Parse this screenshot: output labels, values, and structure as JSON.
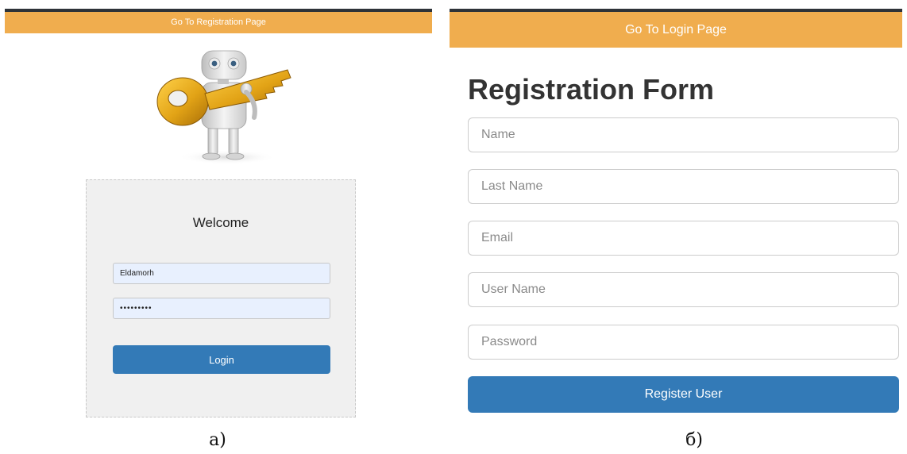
{
  "colors": {
    "topbar_bg": "#f0ad4e",
    "topbar_border": "#2e3338",
    "primary_button": "#337ab7",
    "login_box_bg": "#f0f0f0",
    "autofill_bg": "#e8f0fe"
  },
  "login_page": {
    "topbar_link": "Go To Registration Page",
    "illustration_icon": "robot-with-key-icon",
    "heading": "Welcome",
    "username_value": "Eldamorh",
    "password_value": "•••••••••",
    "login_label": "Login",
    "caption": "а)"
  },
  "registration_page": {
    "topbar_link": "Go To Login Page",
    "title": "Registration Form",
    "fields": {
      "name_placeholder": "Name",
      "last_name_placeholder": "Last Name",
      "email_placeholder": "Email",
      "user_name_placeholder": "User Name",
      "password_placeholder": "Password"
    },
    "register_label": "Register User",
    "caption": "б)"
  }
}
